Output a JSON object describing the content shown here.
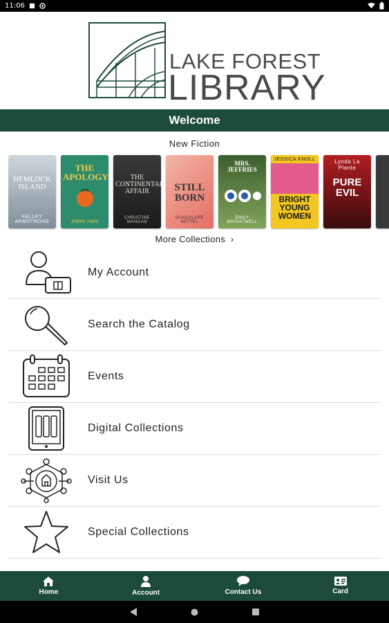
{
  "status_bar": {
    "time": "11:06"
  },
  "header": {
    "logo_line1": "LAKE FOREST",
    "logo_line2": "LIBRARY"
  },
  "welcome": "Welcome",
  "carousel": {
    "title": "New Fiction",
    "books": [
      {
        "title": "HEMLOCK ISLAND",
        "author": "KELLEY ARMSTRONG",
        "bg": "#9aa6b0"
      },
      {
        "title": "THE APOLOGY",
        "author": "JIMIN HAN",
        "bg": "#2e8c6e"
      },
      {
        "title": "THE CONTINENTAL AFFAIR",
        "author": "CHRISTINE MANGAN",
        "bg": "#2b2b2b"
      },
      {
        "title": "STILL BORN",
        "author": "GUADALUPE NETTEL",
        "bg": "#e98a7a"
      },
      {
        "title": "MRS. JEFFRIES",
        "author": "EMILY BRIGHTWELL",
        "bg": "#5f7f3a"
      },
      {
        "title": "BRIGHT YOUNG WOMEN",
        "author": "JESSICA KNOLL",
        "bg": "#f3c621"
      },
      {
        "title": "PURE EVIL",
        "author": "Lynda La Plante",
        "bg": "#b11e22"
      }
    ],
    "more_label": "More Collections"
  },
  "menu": [
    {
      "label": "My Account",
      "icon": "account-card-icon"
    },
    {
      "label": "Search the Catalog",
      "icon": "magnifier-icon"
    },
    {
      "label": "Events",
      "icon": "calendar-icon"
    },
    {
      "label": "Digital Collections",
      "icon": "tablet-books-icon"
    },
    {
      "label": "Visit Us",
      "icon": "library-network-icon"
    },
    {
      "label": "Special Collections",
      "icon": "star-icon"
    }
  ],
  "bottom_nav": [
    {
      "label": "Home",
      "icon": "home-icon"
    },
    {
      "label": "Account",
      "icon": "person-icon"
    },
    {
      "label": "Contact Us",
      "icon": "chat-bubble-icon"
    },
    {
      "label": "Card",
      "icon": "id-card-icon"
    }
  ],
  "colors": {
    "brand_green": "#1c4a3d",
    "logo_gray": "#4a4a4a"
  }
}
